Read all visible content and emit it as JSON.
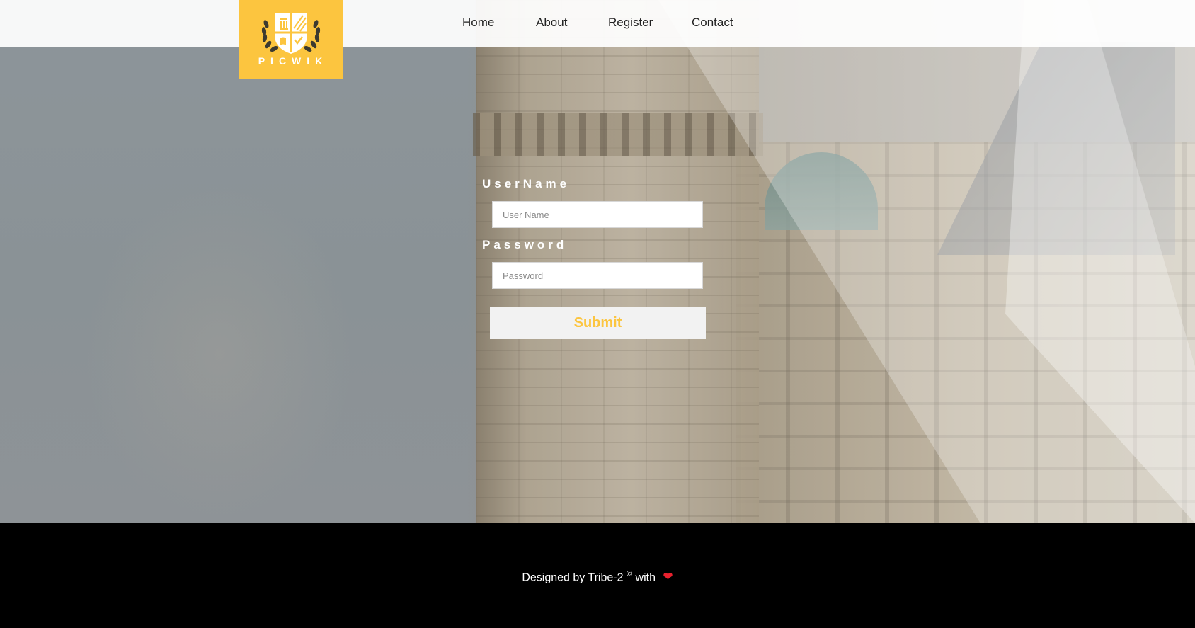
{
  "header": {
    "logo_text": "PICWIK",
    "nav": [
      {
        "label": "Home"
      },
      {
        "label": "About"
      },
      {
        "label": "Register"
      },
      {
        "label": "Contact"
      }
    ]
  },
  "login_form": {
    "username_label": "UserName",
    "username_placeholder": "User Name",
    "username_value": "",
    "password_label": "Password",
    "password_placeholder": "Password",
    "password_value": "",
    "submit_label": "Submit"
  },
  "footer": {
    "text": "Designed by Tribe-2",
    "copyright_symbol": "©",
    "with_text": "with",
    "heart": "❤"
  },
  "colors": {
    "accent": "#fcc53f",
    "footer_bg": "#000000",
    "heart": "#e8212e"
  },
  "icons": {
    "logo": "shield-laurel-icon",
    "heart": "heart-icon"
  }
}
